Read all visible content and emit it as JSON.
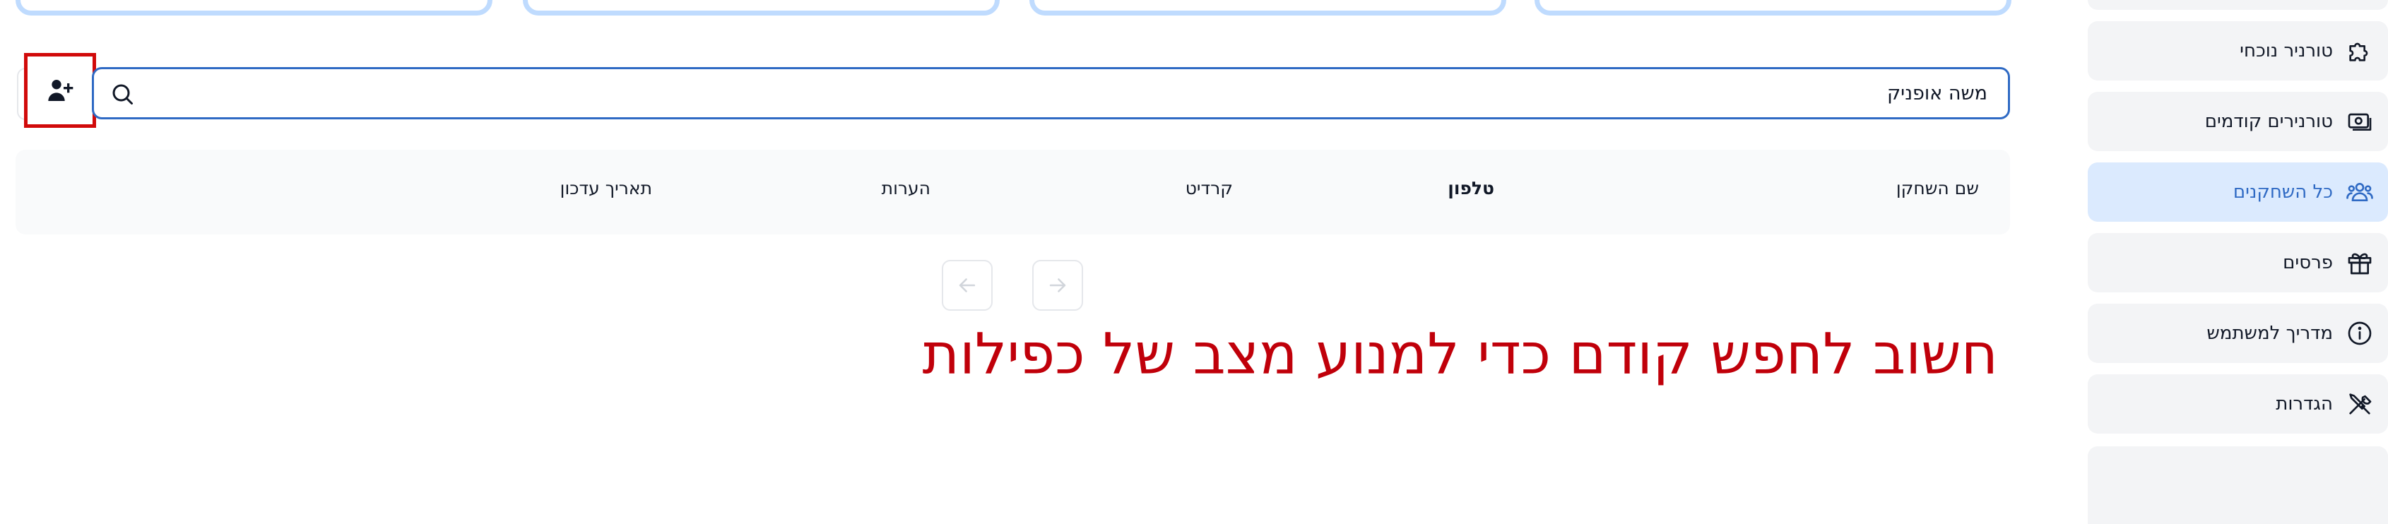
{
  "sidebar": {
    "items": [
      {
        "label": "טורניר נוכחי",
        "icon": "puzzle-icon",
        "active": false
      },
      {
        "label": "טורנירים קודמים",
        "icon": "banknote-icon",
        "active": false
      },
      {
        "label": "כל השחקנים",
        "icon": "users-icon",
        "active": true
      },
      {
        "label": "פרסים",
        "icon": "gift-icon",
        "active": false
      },
      {
        "label": "מדריך למשתמש",
        "icon": "info-icon",
        "active": false
      },
      {
        "label": "הגדרות",
        "icon": "tools-icon",
        "active": false
      }
    ]
  },
  "search": {
    "value": "משה אופניק",
    "placeholder": ""
  },
  "add_player_icon": "user-plus-icon",
  "table": {
    "columns": [
      "שם השחקן",
      "טלפון",
      "קרדיט",
      "הערות",
      "תאריך עדכון"
    ],
    "bold_column": "טלפון"
  },
  "pagination": {
    "prev_icon": "arrow-left-icon",
    "next_icon": "arrow-right-icon",
    "disabled": true
  },
  "warning": "חשוב לחפש קודם כדי למנוע מצב של כפילות",
  "colors": {
    "accent": "#2f6ac4",
    "active_bg": "#dbeafe",
    "card_border": "#bfdbfe",
    "warning": "#c0000a",
    "highlight_box": "#d10a0a"
  }
}
